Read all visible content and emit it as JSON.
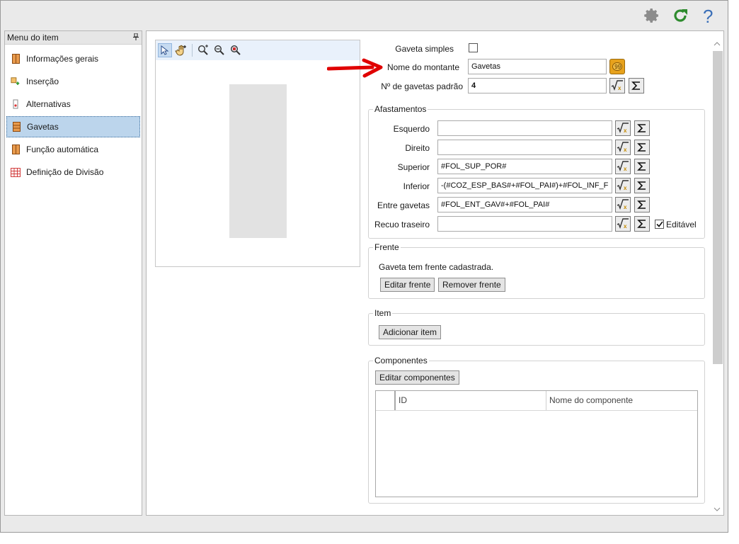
{
  "toolbar_icons": [
    "gear-icon",
    "refresh-icon",
    "help-icon"
  ],
  "sidebar": {
    "title": "Menu do item",
    "pin_glyph": "⊥",
    "items": [
      {
        "label": "Informações gerais",
        "icon": "cabinet-icon"
      },
      {
        "label": "Inserção",
        "icon": "insert-icon"
      },
      {
        "label": "Alternativas",
        "icon": "alternatives-icon"
      },
      {
        "label": "Gavetas",
        "icon": "drawers-icon",
        "active": true
      },
      {
        "label": "Função automática",
        "icon": "automatic-function-icon"
      },
      {
        "label": "Definição de Divisão",
        "icon": "grid-division-icon"
      }
    ]
  },
  "preview": {
    "tools": [
      "select-pointer-icon",
      "pan-hand-icon",
      "zoom-in-icon",
      "zoom-out-icon",
      "zoom-fit-icon"
    ]
  },
  "form": {
    "gaveta_simples_label": "Gaveta simples",
    "nome_montante_label": "Nome do montante",
    "nome_montante_value": "Gavetas",
    "num_gavetas_label": "Nº de gavetas padrão",
    "num_gavetas_value": "4"
  },
  "afastamentos": {
    "title": "Afastamentos",
    "rows": [
      {
        "label": "Esquerdo",
        "value": ""
      },
      {
        "label": "Direito",
        "value": ""
      },
      {
        "label": "Superior",
        "value": "#FOL_SUP_POR#"
      },
      {
        "label": "Inferior",
        "value": "-(#COZ_ESP_BAS#+#FOL_PAI#)+#FOL_INF_F"
      },
      {
        "label": "Entre gavetas",
        "value": "#FOL_ENT_GAV#+#FOL_PAI#"
      },
      {
        "label": "Recuo traseiro",
        "value": ""
      }
    ],
    "editavel_label": "Editável",
    "editavel_checked": true
  },
  "frente": {
    "title": "Frente",
    "status": "Gaveta tem frente cadastrada.",
    "edit_btn": "Editar frente",
    "remove_btn": "Remover frente"
  },
  "item": {
    "title": "Item",
    "add_btn": "Adicionar item"
  },
  "componentes": {
    "title": "Componentes",
    "edit_btn": "Editar componentes",
    "columns": [
      "ID",
      "Nome do componente"
    ]
  },
  "colors": {
    "arrow": "#e00000",
    "active_item": "#bcd5ec",
    "gear": "#8c8c8c",
    "refresh": "#2e8b2e",
    "help": "#3a6fb8"
  }
}
